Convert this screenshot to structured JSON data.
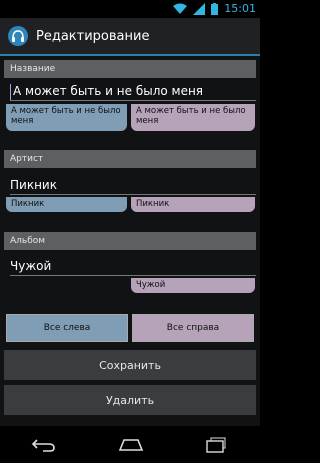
{
  "statusbar": {
    "time": "15:01"
  },
  "actionbar": {
    "title": "Редактирование"
  },
  "sections": {
    "title": {
      "header": "Название",
      "value": "А может быть и не было меня",
      "left": "А может быть и не было меня",
      "right": "А может быть и не было меня"
    },
    "artist": {
      "header": "Артист",
      "value": "Пикник",
      "left": "Пикник",
      "right": "Пикник"
    },
    "album": {
      "header": "Альбом",
      "value": "Чужой",
      "right": "Чужой"
    }
  },
  "buttons": {
    "all_left": "Все слева",
    "all_right": "Все справа",
    "save": "Сохранить",
    "delete": "Удалить"
  },
  "icons": {
    "wifi": "wifi-icon",
    "signal": "signal-icon",
    "battery": "battery-icon",
    "app": "headphones-icon",
    "back": "back-icon",
    "home": "home-icon",
    "recents": "recents-icon"
  },
  "colors": {
    "accent": "#33b5e5",
    "left_chip": "#7f9db5",
    "right_chip": "#b6a2b9"
  }
}
